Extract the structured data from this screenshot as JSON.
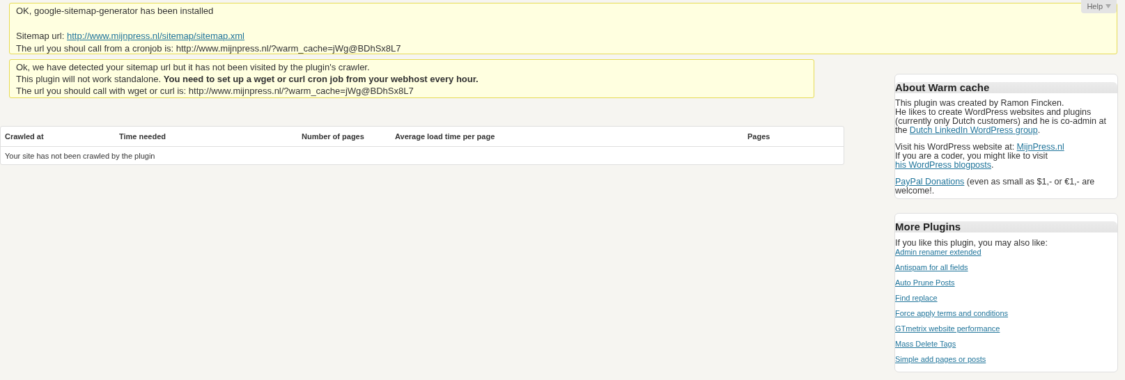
{
  "help_tab": {
    "label": "Help"
  },
  "notices": [
    {
      "paragraphs": [
        [
          {
            "parts": [
              {
                "kind": "text",
                "text": "OK, google-sitemap-generator has been installed"
              }
            ]
          }
        ],
        [
          {
            "parts": [
              {
                "kind": "text",
                "text": "Sitemap url: "
              },
              {
                "kind": "link",
                "text": "http://www.mijnpress.nl/sitemap/sitemap.xml"
              }
            ]
          },
          {
            "parts": [
              {
                "kind": "text",
                "text": "The url you shoul call from a cronjob is: http://www.mijnpress.nl/?warm_cache=jWg@BDhSx8L7"
              }
            ]
          }
        ]
      ]
    },
    {
      "paragraphs": [
        [
          {
            "parts": [
              {
                "kind": "text",
                "text": "Ok, we have detected your sitemap url but it has not been visited by the plugin's crawler."
              }
            ]
          },
          {
            "parts": [
              {
                "kind": "text",
                "text": "This plugin will not work standalone. **You need to set up a wget or curl cron job from your webhost every hour.**"
              }
            ]
          },
          {
            "parts": [
              {
                "kind": "text",
                "text": "The url you should call with wget or curl is: http://www.mijnpress.nl/?warm_cache=jWg@BDhSx8L7"
              }
            ]
          }
        ]
      ]
    }
  ],
  "table": {
    "columns": [
      "Crawled at",
      "Time needed",
      "Number of pages",
      "Average load time per page",
      "Pages"
    ],
    "empty_message": "Your site has not been crawled by the plugin"
  },
  "sidebar": [
    {
      "title": "About Warm cache",
      "paragraphs": [
        [
          [
            {
              "kind": "text",
              "text": "This plugin was created by Ramon Fincken."
            }
          ],
          [
            {
              "kind": "text",
              "text": "He likes to create WordPress websites and plugins (currently only Dutch customers) and he is co-admin at the "
            },
            {
              "kind": "link",
              "text": "Dutch LinkedIn WordPress group"
            },
            {
              "kind": "text",
              "text": "."
            }
          ]
        ],
        [
          [
            {
              "kind": "text",
              "text": "Visit his WordPress website at: "
            },
            {
              "kind": "link",
              "text": "MijnPress.nl"
            }
          ],
          [
            {
              "kind": "text",
              "text": "If you are a coder, you might like to visit "
            },
            {
              "kind": "link",
              "text": "his WordPress blogposts"
            },
            {
              "kind": "text",
              "text": "."
            }
          ]
        ],
        [
          [
            {
              "kind": "link",
              "text": "PayPal Donations"
            },
            {
              "kind": "text",
              "text": " (even as small as $1,- or €1,- are welcome!."
            }
          ]
        ]
      ]
    },
    {
      "title": "More Plugins",
      "intro": "If you like this plugin, you may also like:",
      "links": [
        "Admin renamer extended",
        "Antispam for all fields",
        "Auto Prune Posts",
        "Find replace",
        "Force apply terms and conditions",
        "GTmetrix website performance",
        "Mass Delete Tags",
        "Simple add pages or posts"
      ]
    }
  ]
}
